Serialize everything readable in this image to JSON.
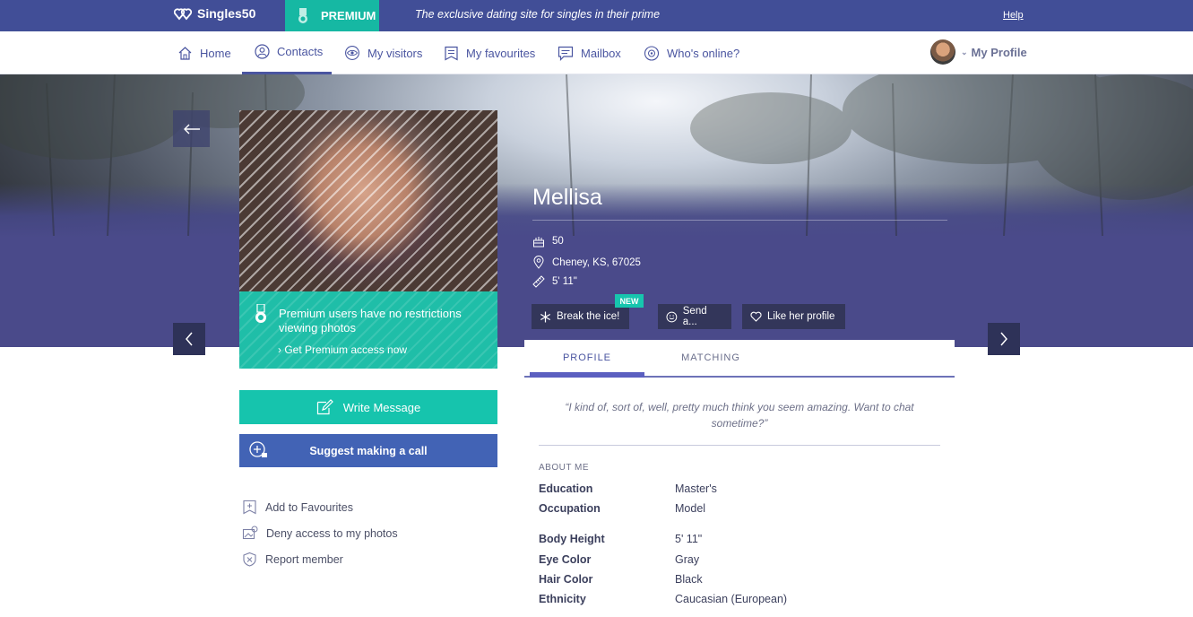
{
  "topbar": {
    "logo": "Singles50",
    "premium_label": "PREMIUM",
    "tagline": "The exclusive dating site for singles in their prime",
    "help": "Help"
  },
  "nav": {
    "items": [
      {
        "label": "Home",
        "icon": "home-icon"
      },
      {
        "label": "Contacts",
        "icon": "person-icon",
        "active": true
      },
      {
        "label": "My visitors",
        "icon": "eye-icon"
      },
      {
        "label": "My favourites",
        "icon": "bookmark-icon"
      },
      {
        "label": "Mailbox",
        "icon": "chat-icon"
      },
      {
        "label": "Who's online?",
        "icon": "online-icon"
      }
    ],
    "profile_label": "My Profile"
  },
  "photo_panel": {
    "premium_message": "Premium users have no restrictions viewing photos",
    "premium_cta": "Get Premium access now",
    "write_message": "Write Message",
    "suggest_call": "Suggest making a call"
  },
  "side_links": {
    "favourites": "Add to Favourites",
    "deny_photos": "Deny access to my photos",
    "report": "Report member"
  },
  "profile": {
    "name": "Mellisa",
    "age": "50",
    "location": "Cheney, KS, 67025",
    "height": "5' 11\""
  },
  "actions": {
    "break_ice": "Break the ice!",
    "new_badge": "NEW",
    "send": "Send a...",
    "like": "Like her profile"
  },
  "tabs": {
    "profile": "PROFILE",
    "matching": "MATCHING"
  },
  "about": {
    "quote": "“I kind of, sort of, well, pretty much think you seem amazing. Want to chat sometime?”",
    "section_title": "ABOUT ME",
    "attributes": [
      {
        "label": "Education",
        "value": "Master's"
      },
      {
        "label": "Occupation",
        "value": "Model"
      },
      {
        "label": "Body Height",
        "value": "5' 11\""
      },
      {
        "label": "Eye Color",
        "value": "Gray"
      },
      {
        "label": "Hair Color",
        "value": "Black"
      },
      {
        "label": "Ethnicity",
        "value": "Caucasian (European)"
      }
    ]
  },
  "colors": {
    "topbar": "#414e97",
    "accent_teal": "#16c4ad",
    "call_blue": "#4263b5",
    "hero_purple": "#4a4a8a"
  }
}
